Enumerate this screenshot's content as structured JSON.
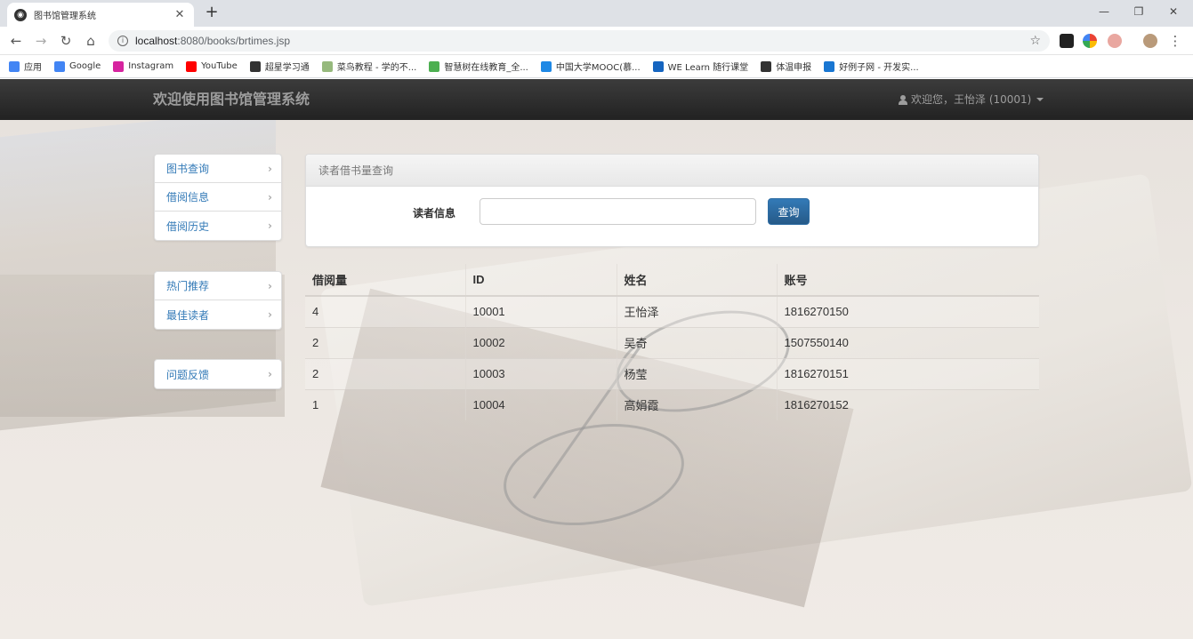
{
  "browser": {
    "tab_title": "图书馆管理系统",
    "url_host": "localhost",
    "url_rest": ":8080/books/brtimes.jsp",
    "bookmarks": [
      {
        "label": "应用",
        "icon": "apps-grid-icon",
        "color": "#4285f4"
      },
      {
        "label": "Google",
        "icon": "google-icon",
        "color": "#4285f4"
      },
      {
        "label": "Instagram",
        "icon": "instagram-icon",
        "color": "#d6249f"
      },
      {
        "label": "YouTube",
        "icon": "youtube-icon",
        "color": "#ff0000"
      },
      {
        "label": "超星学习通",
        "icon": "globe-icon",
        "color": "#333333"
      },
      {
        "label": "菜鸟教程 - 学的不...",
        "icon": "runoob-icon",
        "color": "#96b97d"
      },
      {
        "label": "智慧树在线教育_全...",
        "icon": "zhihuishu-icon",
        "color": "#4caf50"
      },
      {
        "label": "中国大学MOOC(慕...",
        "icon": "mooc-icon",
        "color": "#1e88e5"
      },
      {
        "label": "WE Learn 随行课堂",
        "icon": "welearn-icon",
        "color": "#1565c0"
      },
      {
        "label": "体温申报",
        "icon": "globe-icon",
        "color": "#333333"
      },
      {
        "label": "好例子网 - 开发实...",
        "icon": "haolizi-icon",
        "color": "#1976d2"
      }
    ]
  },
  "navbar": {
    "brand": "欢迎使用图书馆管理系统",
    "user": "欢迎您，王怡泽 (10001)"
  },
  "sidebar": {
    "group1": [
      {
        "label": "图书查询"
      },
      {
        "label": "借阅信息"
      },
      {
        "label": "借阅历史"
      }
    ],
    "group2": [
      {
        "label": "热门推荐"
      },
      {
        "label": "最佳读者"
      }
    ],
    "group3": [
      {
        "label": "问题反馈"
      }
    ]
  },
  "query_panel": {
    "heading": "读者借书量查询",
    "field_label": "读者信息",
    "field_value": "",
    "button_label": "查询"
  },
  "table": {
    "headers": [
      "借阅量",
      "ID",
      "姓名",
      "账号"
    ],
    "rows": [
      [
        "4",
        "10001",
        "王怡泽",
        "1816270150"
      ],
      [
        "2",
        "10002",
        "吴奇",
        "1507550140"
      ],
      [
        "2",
        "10003",
        "杨莹",
        "1816270151"
      ],
      [
        "1",
        "10004",
        "高娟霞",
        "1816270152"
      ]
    ]
  }
}
